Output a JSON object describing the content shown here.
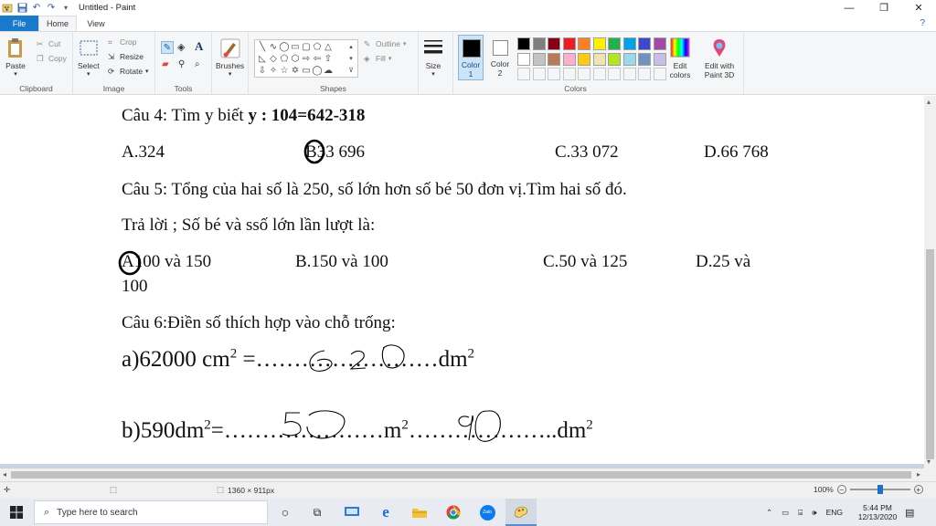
{
  "window": {
    "title": "Untitled - Paint",
    "controls": {
      "minimize": "—",
      "restore": "❐",
      "close": "✕"
    }
  },
  "ribbon_tabs": {
    "file": "File",
    "home": "Home",
    "view": "View"
  },
  "clipboard": {
    "paste": "Paste",
    "cut": "Cut",
    "copy": "Copy",
    "group": "Clipboard"
  },
  "image": {
    "select": "Select",
    "crop": "Crop",
    "resize": "Resize",
    "rotate": "Rotate",
    "group": "Image"
  },
  "tools": {
    "group": "Tools",
    "text_tool": "A"
  },
  "brushes": {
    "label": "Brushes"
  },
  "shapes": {
    "outline": "Outline",
    "fill": "Fill",
    "group": "Shapes"
  },
  "size": {
    "label": "Size"
  },
  "colors": {
    "color1_label": "Color",
    "color1_num": "1",
    "color2_label": "Color",
    "color2_num": "2",
    "edit_colors_line1": "Edit",
    "edit_colors_line2": "colors",
    "edit_paint3d_line1": "Edit with",
    "edit_paint3d_line2": "Paint 3D",
    "group": "Colors",
    "palette_row1": [
      "#000000",
      "#7f7f7f",
      "#880015",
      "#ed1c24",
      "#ff7f27",
      "#fff200",
      "#22b14c",
      "#00a2e8",
      "#3f48cc",
      "#a349a4"
    ],
    "palette_row2": [
      "#ffffff",
      "#c3c3c3",
      "#b97a57",
      "#ffaec9",
      "#ffc90e",
      "#efe4b0",
      "#b5e61d",
      "#99d9ea",
      "#7092be",
      "#c8bfe7"
    ]
  },
  "document": {
    "q4": {
      "prefix": "Câu 4: Tìm y biết ",
      "bold": "y : 104=642-318"
    },
    "q4_answers": {
      "a": "A.324",
      "b": "33 696",
      "b_letter": "B",
      "c": "C.33 072",
      "d": "D.66 768"
    },
    "q5": "Câu 5: Tổng của hai số là 250, số lớn hơn số bé 50 đơn vị.Tìm hai số đó.",
    "q5_hint": "Trả lời ; Số bé và ssố lớn lần lượt là:",
    "q5_answers": {
      "a_letter": "A",
      "a": "100 và 150",
      "b": "B.150 và 100",
      "c": "C.50 và 125",
      "d": "D.25 và",
      "d_wrap": "100"
    },
    "q6": "Câu 6:Điền số thích hợp vào chỗ trống:",
    "q6a": {
      "left": "a)62000 cm",
      "mid": " =……………………dm",
      "exp": "2"
    },
    "q6b": {
      "left": "b)590dm",
      "mid": "=…………………m",
      "tail": "………………..dm",
      "exp": "2"
    },
    "handwriting": {
      "a_answer": "620",
      "b_m2": "5",
      "b_dm2": "90"
    }
  },
  "statusbar": {
    "dimensions": "1360 × 911px",
    "zoom": "100%"
  },
  "taskbar": {
    "search_placeholder": "Type here to search",
    "language": "ENG",
    "time": "5:44 PM",
    "date": "12/13/2020"
  }
}
